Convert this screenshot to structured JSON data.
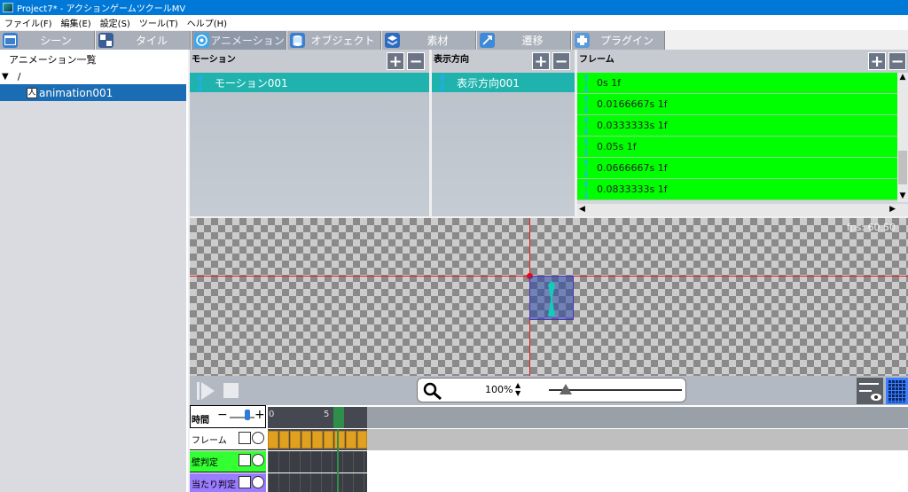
{
  "window": {
    "title": "Project7* - アクションゲームツクールMV"
  },
  "menu": [
    "ファイル(F)",
    "編集(E)",
    "設定(S)",
    "ツール(T)",
    "ヘルプ(H)"
  ],
  "tabs": [
    {
      "label": "シーン",
      "icon": "scene-icon",
      "color": "#3a7fd0"
    },
    {
      "label": "タイル",
      "icon": "tile-icon",
      "color": "#3b5f94"
    },
    {
      "label": "アニメーション",
      "icon": "animation-icon",
      "color": "#3fa6e8"
    },
    {
      "label": "オブジェクト",
      "icon": "object-icon",
      "color": "#3a7fd0"
    },
    {
      "label": "素材",
      "icon": "material-icon",
      "color": "#2f6cc0"
    },
    {
      "label": "遷移",
      "icon": "transition-icon",
      "color": "#3f8ad8"
    },
    {
      "label": "プラグイン",
      "icon": "plugin-icon",
      "color": "#5a9ad8"
    }
  ],
  "left_panel": {
    "header": "アニメーション一覧",
    "root": "/",
    "items": [
      {
        "label": "animation001"
      }
    ]
  },
  "motion": {
    "header": "モーション",
    "items": [
      "モーション001"
    ]
  },
  "direction": {
    "header": "表示方向",
    "items": [
      "表示方向001"
    ]
  },
  "frames": {
    "header": "フレーム",
    "items": [
      "0s 1f",
      "0.0166667s 1f",
      "0.0333333s 1f",
      "0.05s 1f",
      "0.0666667s 1f",
      "0.0833333s 1f"
    ]
  },
  "canvas": {
    "fps": "fps: 60.50"
  },
  "zoom": {
    "value": "100%"
  },
  "timeline": {
    "time_label": "時間",
    "ruler": [
      "0",
      "5"
    ],
    "tracks": [
      {
        "label": "フレーム",
        "color": "#ffffff"
      },
      {
        "label": "壁判定",
        "color": "#33ff33"
      },
      {
        "label": "当たり判定",
        "color": "#9a7cff"
      }
    ]
  }
}
